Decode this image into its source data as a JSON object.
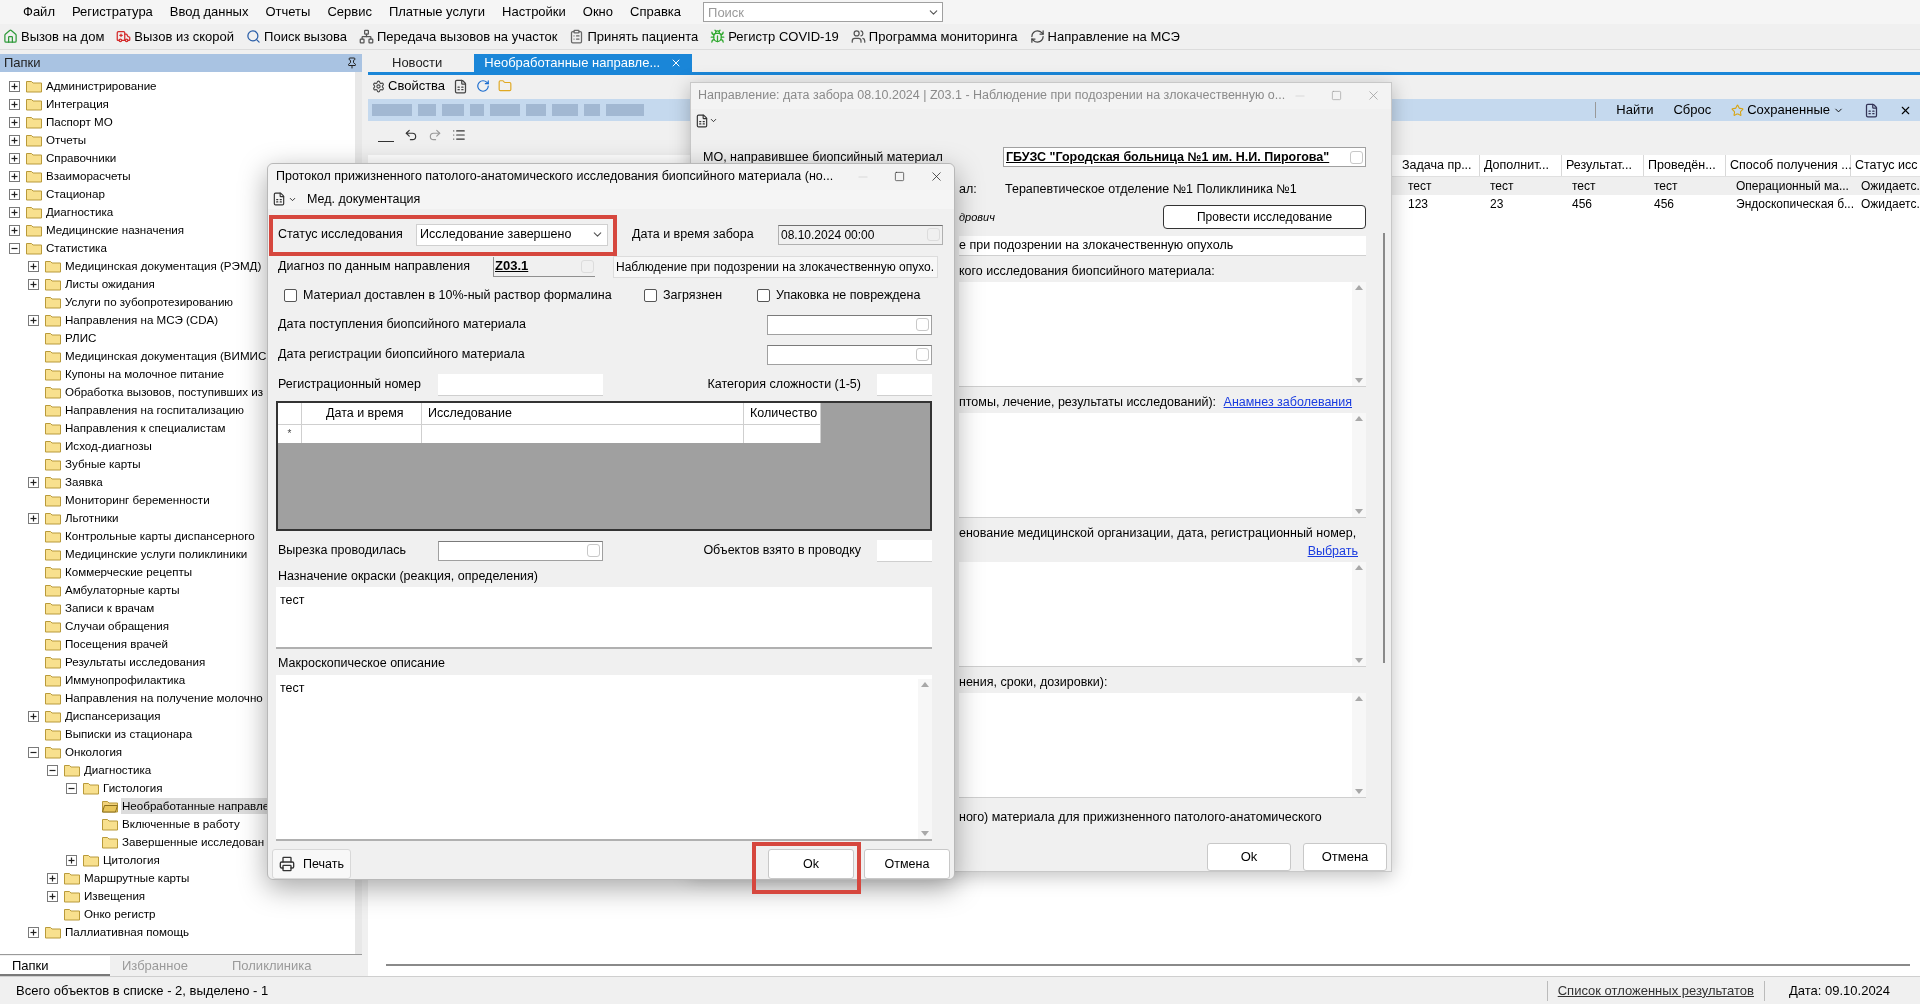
{
  "menu": [
    "Файл",
    "Регистратура",
    "Ввод данных",
    "Отчеты",
    "Сервис",
    "Платные услуги",
    "Настройки",
    "Окно",
    "Справка"
  ],
  "search": {
    "placeholder": "Поиск"
  },
  "toolbar": [
    {
      "label": "Вызов на дом",
      "kind": "house"
    },
    {
      "label": "Вызов из скорой",
      "kind": "ambulance"
    },
    {
      "label": "Поиск вызова",
      "kind": "search"
    },
    {
      "label": "Передача вызовов на участок",
      "kind": "network"
    },
    {
      "label": "Принять пациента",
      "kind": "clipboard"
    },
    {
      "label": "Регистр COVID-19",
      "kind": "virus"
    },
    {
      "label": "Программа мониторинга",
      "kind": "users"
    },
    {
      "label": "Направление на МСЭ",
      "kind": "refresh"
    }
  ],
  "folders_panel": {
    "title": "Папки",
    "tree": [
      {
        "label": "Администрирование",
        "expandable": true,
        "selected": false
      },
      {
        "label": "Интеграция",
        "expandable": true,
        "selected": false
      },
      {
        "label": "Паспорт МО",
        "expandable": true,
        "selected": false
      },
      {
        "label": "Отчеты",
        "expandable": true,
        "selected": false
      },
      {
        "label": "Справочники",
        "expandable": true,
        "selected": false
      },
      {
        "label": "Взаиморасчеты",
        "expandable": true,
        "selected": false
      },
      {
        "label": "Стационар",
        "expandable": true,
        "selected": false
      },
      {
        "label": "Диагностика",
        "expandable": true,
        "selected": false
      },
      {
        "label": "Медицинские назначения",
        "expandable": true,
        "selected": false
      },
      {
        "label": "Статистика",
        "expandable": true,
        "selected": false,
        "children": [
          {
            "label": "Медицинская документация (РЭМД)",
            "expandable": true,
            "selected": false
          },
          {
            "label": "Листы ожидания",
            "expandable": true,
            "selected": false
          },
          {
            "label": "Услуги по зубопротезированию",
            "expandable": false,
            "selected": false
          },
          {
            "label": "Направления на МСЭ (CDA)",
            "expandable": true,
            "selected": false
          },
          {
            "label": "РЛИС",
            "expandable": false,
            "selected": false
          },
          {
            "label": "Медицинская документация (ВИМИС",
            "expandable": false,
            "selected": false
          },
          {
            "label": "Купоны на молочное питание",
            "expandable": false,
            "selected": false
          },
          {
            "label": "Обработка вызовов, поступивших из",
            "expandable": false,
            "selected": false
          },
          {
            "label": "Направления на госпитализацию",
            "expandable": false,
            "selected": false
          },
          {
            "label": "Направления к специалистам",
            "expandable": false,
            "selected": false
          },
          {
            "label": "Исход-диагнозы",
            "expandable": false,
            "selected": false
          },
          {
            "label": "Зубные карты",
            "expandable": false,
            "selected": false
          },
          {
            "label": "Заявка",
            "expandable": true,
            "selected": false
          },
          {
            "label": "Мониторинг беременности",
            "expandable": false,
            "selected": false
          },
          {
            "label": "Льготники",
            "expandable": true,
            "selected": false
          },
          {
            "label": "Контрольные карты диспансерного",
            "expandable": false,
            "selected": false
          },
          {
            "label": "Медицинские услуги поликлиники",
            "expandable": false,
            "selected": false
          },
          {
            "label": "Коммерческие рецепты",
            "expandable": false,
            "selected": false
          },
          {
            "label": "Амбулаторные карты",
            "expandable": false,
            "selected": false
          },
          {
            "label": "Записи к врачам",
            "expandable": false,
            "selected": false
          },
          {
            "label": "Случаи обращения",
            "expandable": false,
            "selected": false
          },
          {
            "label": "Посещения врачей",
            "expandable": false,
            "selected": false
          },
          {
            "label": "Результаты исследования",
            "expandable": false,
            "selected": false
          },
          {
            "label": "Иммунопрофилактика",
            "expandable": false,
            "selected": false
          },
          {
            "label": "Направления на получение молочно",
            "expandable": false,
            "selected": false
          },
          {
            "label": "Диспансеризация",
            "expandable": true,
            "selected": false
          },
          {
            "label": "Выписки из стационара",
            "expandable": false,
            "selected": false
          },
          {
            "label": "Онкология",
            "expandable": true,
            "selected": false,
            "children": [
              {
                "label": "Диагностика",
                "expandable": true,
                "selected": false,
                "children": [
                  {
                    "label": "Гистология",
                    "expandable": true,
                    "selected": false,
                    "children": [
                      {
                        "label": "Необработанные направле",
                        "expandable": false,
                        "selected": true
                      },
                      {
                        "label": "Включенные в работу",
                        "expandable": false,
                        "selected": false
                      },
                      {
                        "label": "Завершенные исследован",
                        "expandable": false,
                        "selected": false
                      }
                    ]
                  },
                  {
                    "label": "Цитология",
                    "expandable": true,
                    "selected": false
                  }
                ]
              },
              {
                "label": "Маршрутные карты",
                "expandable": true,
                "selected": false
              },
              {
                "label": "Извещения",
                "expandable": true,
                "selected": false
              },
              {
                "label": "Онко регистр",
                "expandable": false,
                "selected": false
              }
            ]
          },
          {
            "label": "Паллиативная помощь",
            "expandable": true,
            "selected": false
          }
        ]
      }
    ],
    "tabs": [
      {
        "label": "Папки",
        "selected": true
      },
      {
        "label": "Избранное",
        "selected": false
      },
      {
        "label": "Поликлиника",
        "selected": false
      }
    ]
  },
  "doc_tabs": [
    {
      "label": "Новости",
      "selected": false,
      "closable": false
    },
    {
      "label": "Необработанные направле...",
      "selected": true,
      "closable": true
    }
  ],
  "list_toolbar": {
    "properties": "Свойства"
  },
  "filter_bar": {
    "find": "Найти",
    "reset": "Сброс",
    "saved": "Сохраненные"
  },
  "table": {
    "columns": [
      "Задача пр...",
      "Дополнит...",
      "Результат...",
      "Проведён...",
      "Способ получения ...",
      "Статус исс"
    ],
    "rows": [
      [
        "тест",
        "тест",
        "тест",
        "тест",
        "Операционный ма...",
        "Ожидаетс."
      ],
      [
        "123",
        "23",
        "456",
        "456",
        "Эндоскопическая б...",
        "Ожидаетс."
      ]
    ]
  },
  "referral_window": {
    "title": "Направление: дата забора 08.10.2024 | Z03.1 - Наблюдение при подозрении на злокачественную о...",
    "mo_label": "МО, направившее биопсийный материал",
    "mo_value": "ГБУЗС \"Городская больница №1 им. Н.И. Пирогова\"",
    "dept_label": "ал:",
    "dept_value": "Терапевтическое отделение №1 Поликлиника №1",
    "doctor": "дрович",
    "research_button": "Провести исследование",
    "diagnosis_text": "е при подозрении на злокачественную опухоль",
    "sections": [
      {
        "label": "кого исследования биопсийного материала:"
      },
      {
        "label": "птомы, лечение, результаты исследований):",
        "link": "Анамнез заболевания"
      },
      {
        "label": "енование медицинской организации, дата, регистрационный номер,",
        "link": "Выбрать"
      },
      {
        "label": "нения, сроки, дозировки):"
      }
    ],
    "footer_text": "ного) материала для прижизненного патолого-анатомического",
    "ok": "Ok",
    "cancel": "Отмена"
  },
  "protocol_dialog": {
    "title": "Протокол прижизненного патолого-анатомического исследования биопсийного материала (но...",
    "toolbar_label": "Мед. документация",
    "status": {
      "label": "Статус исследования",
      "value": "Исследование завершено"
    },
    "sample_date": {
      "label": "Дата и время забора",
      "value": "08.10.2024 00:00"
    },
    "diagnosis": {
      "label": "Диагноз по данным направления",
      "code": "Z03.1",
      "description": "Наблюдение при подозрении на злокачественную опухо."
    },
    "checkboxes": [
      {
        "label": "Материал доставлен в 10%-ный раствор формалина",
        "checked": false
      },
      {
        "label": "Загрязнен",
        "checked": false
      },
      {
        "label": "Упаковка не повреждена",
        "checked": false
      }
    ],
    "received_date": {
      "label": "Дата поступления биопсийного материала"
    },
    "registration_date": {
      "label": "Дата регистрации биопсийного материала"
    },
    "reg_number": {
      "label": "Регистрационный номер"
    },
    "complexity": {
      "label": "Категория сложности (1-5)"
    },
    "grid": {
      "columns": [
        "Дата и время",
        "Исследование",
        "Количество"
      ],
      "new_row_marker": "*"
    },
    "cutting": {
      "label": "Вырезка проводилась"
    },
    "objects": {
      "label": "Объектов взято в проводку"
    },
    "staining": {
      "label": "Назначение окраски (реакция, определения)",
      "value": "тест"
    },
    "macro": {
      "label": "Макроскопическое описание",
      "value": "тест"
    },
    "print": "Печать",
    "ok": "Ok",
    "cancel": "Отмена"
  },
  "status_bar": {
    "summary": "Всего объектов в списке - 2, выделено - 1",
    "deferred_link": "Список отложенных результатов",
    "date": "Дата: 09.10.2024"
  }
}
